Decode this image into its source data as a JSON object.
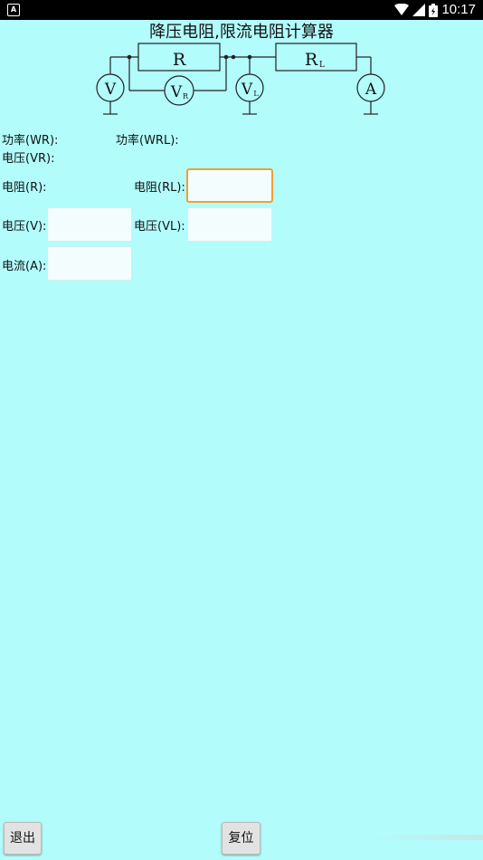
{
  "status_bar": {
    "time": "10:17"
  },
  "title": "降压电阻,限流电阻计算器",
  "circuit": {
    "resistor_r": "R",
    "resistor_rl": "R",
    "resistor_rl_sub": "L",
    "voltmeter_v": "V",
    "voltmeter_vr": "V",
    "voltmeter_vr_sub": "R",
    "voltmeter_vl": "V",
    "voltmeter_vl_sub": "L",
    "ammeter": "A"
  },
  "results": {
    "power_wr_label": "功率(WR):",
    "power_wrl_label": "功率(WRL):",
    "voltage_vr_label": "电压(VR):",
    "resistance_r_label": "电阻(R):"
  },
  "form": {
    "resistance_rl_label": "电阻(RL):",
    "resistance_rl_value": "",
    "voltage_v_label": "电压(V):",
    "voltage_v_value": "",
    "voltage_vl_label": "电压(VL):",
    "voltage_vl_value": "",
    "current_a_label": "电流(A):",
    "current_a_value": ""
  },
  "buttons": {
    "exit": "退出",
    "reset": "复位"
  }
}
